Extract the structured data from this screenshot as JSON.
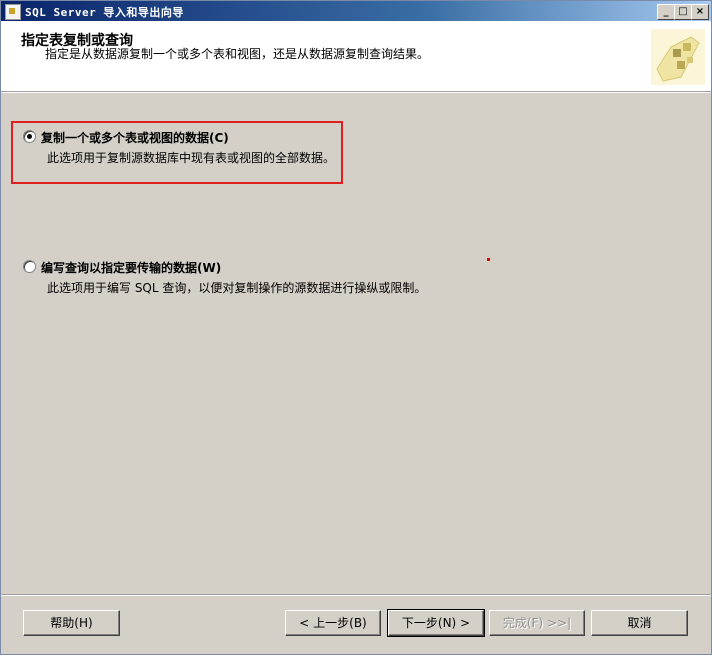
{
  "window": {
    "title": "SQL Server 导入和导出向导"
  },
  "header": {
    "title": "指定表复制或查询",
    "subtitle": "指定是从数据源复制一个或多个表和视图，还是从数据源复制查询结果。"
  },
  "options": [
    {
      "label": "复制一个或多个表或视图的数据(C)",
      "description": "此选项用于复制源数据库中现有表或视图的全部数据。",
      "checked": true
    },
    {
      "label": "编写查询以指定要传输的数据(W)",
      "description": "此选项用于编写 SQL 查询，以便对复制操作的源数据进行操纵或限制。",
      "checked": false
    }
  ],
  "buttons": {
    "help": "帮助(H)",
    "back": "< 上一步(B)",
    "next": "下一步(N) >",
    "finish": "完成(F) >>|",
    "cancel": "取消"
  },
  "colors": {
    "highlight": "#e02020",
    "titlebar": "#0a246a"
  }
}
